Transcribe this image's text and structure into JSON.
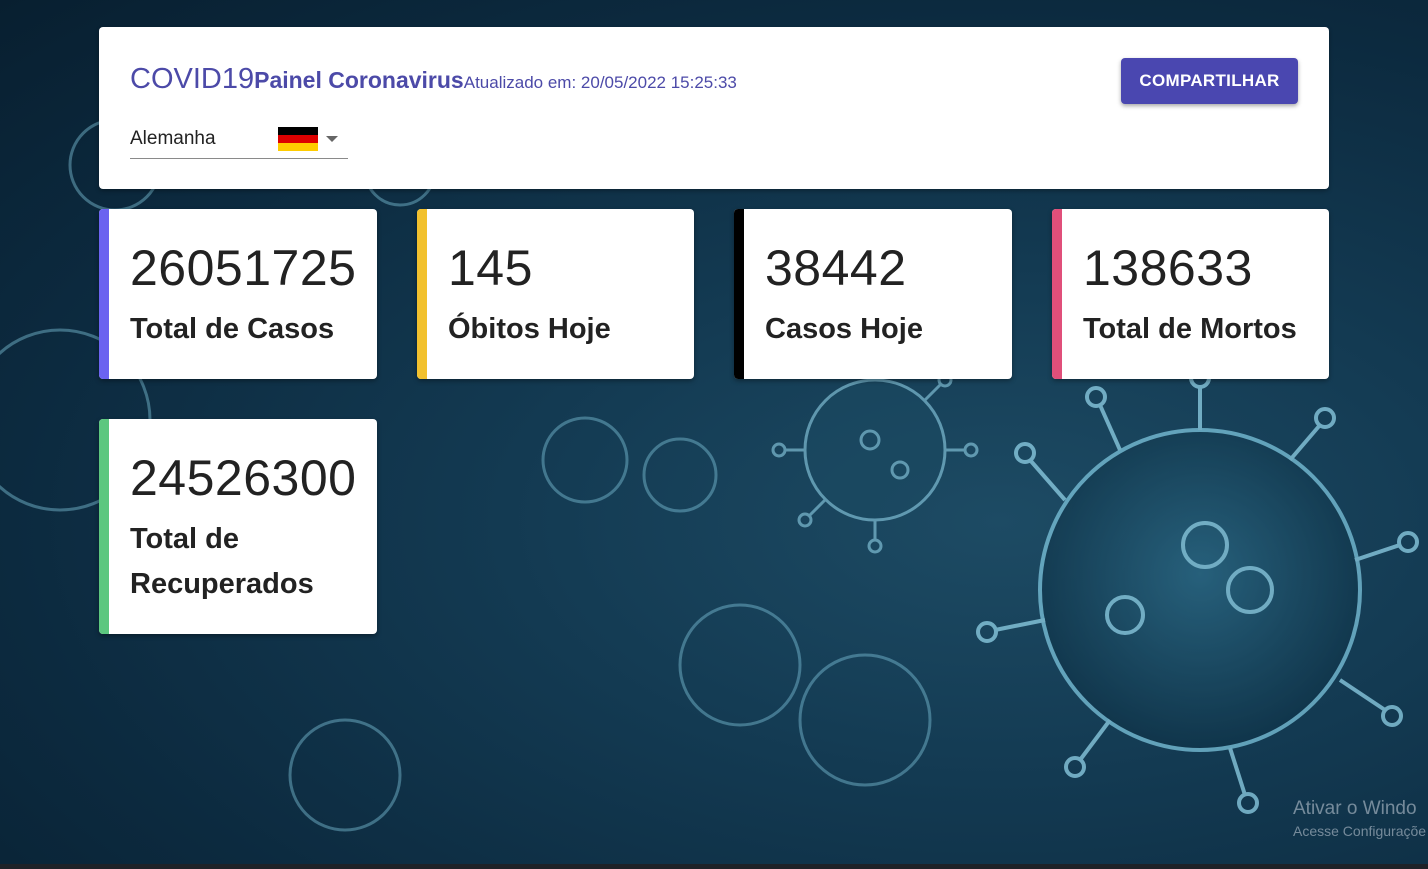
{
  "header": {
    "title": "COVID19",
    "subtitle": "Painel Coronavirus",
    "updated": "Atualizado em: 20/05/2022 15:25:33",
    "share_label": "COMPARTILHAR"
  },
  "country_select": {
    "value": "Alemanha",
    "flag_icon": "germany-flag-icon"
  },
  "stats": [
    {
      "value": "26051725",
      "label": "Total de Casos",
      "accent": "#6b63f0"
    },
    {
      "value": "145",
      "label": "Óbitos Hoje",
      "accent": "#f2c12e"
    },
    {
      "value": "38442",
      "label": "Casos Hoje",
      "accent": "#000000"
    },
    {
      "value": "138633",
      "label": "Total de Mortos",
      "accent": "#e04f7a"
    },
    {
      "value": "24526300",
      "label": "Total de Recuperados",
      "accent": "#5cc77f"
    }
  ],
  "watermark": {
    "line1": "Ativar o Windo",
    "line2": "Acesse Configuraçõe"
  },
  "colors": {
    "brand": "#4c4aa8",
    "button": "#4a47b0"
  }
}
